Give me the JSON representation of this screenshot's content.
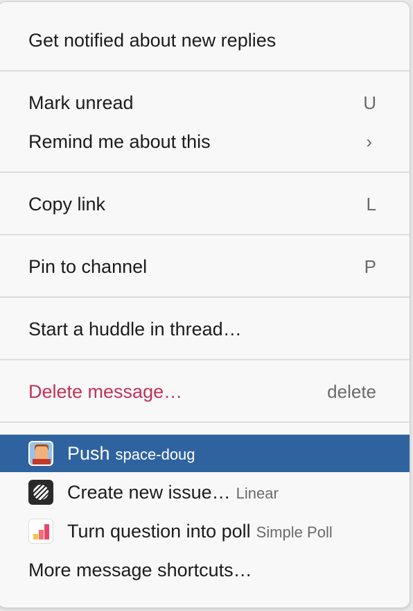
{
  "menu": {
    "items": [
      {
        "label": "Get notified about new replies"
      },
      {
        "label": "Mark unread",
        "shortcut": "U"
      },
      {
        "label": "Remind me about this",
        "chevron": "›"
      },
      {
        "label": "Copy link",
        "shortcut": "L"
      },
      {
        "label": "Pin to channel",
        "shortcut": "P"
      },
      {
        "label": "Start a huddle in thread…"
      },
      {
        "label": "Delete message…",
        "shortcut": "delete",
        "color": "#c0325a"
      }
    ],
    "shortcuts": [
      {
        "label": "Push",
        "app": "space-doug",
        "icon": "push-app-icon",
        "selected": true
      },
      {
        "label": "Create new issue…",
        "app": "Linear",
        "icon": "linear-app-icon"
      },
      {
        "label": "Turn question into poll",
        "app": "Simple Poll",
        "icon": "simple-poll-app-icon"
      }
    ],
    "more_label": "More message shortcuts…"
  },
  "colors": {
    "selected_bg": "#2f63a0",
    "danger": "#c0325a",
    "menu_bg": "#f8f8f8"
  }
}
